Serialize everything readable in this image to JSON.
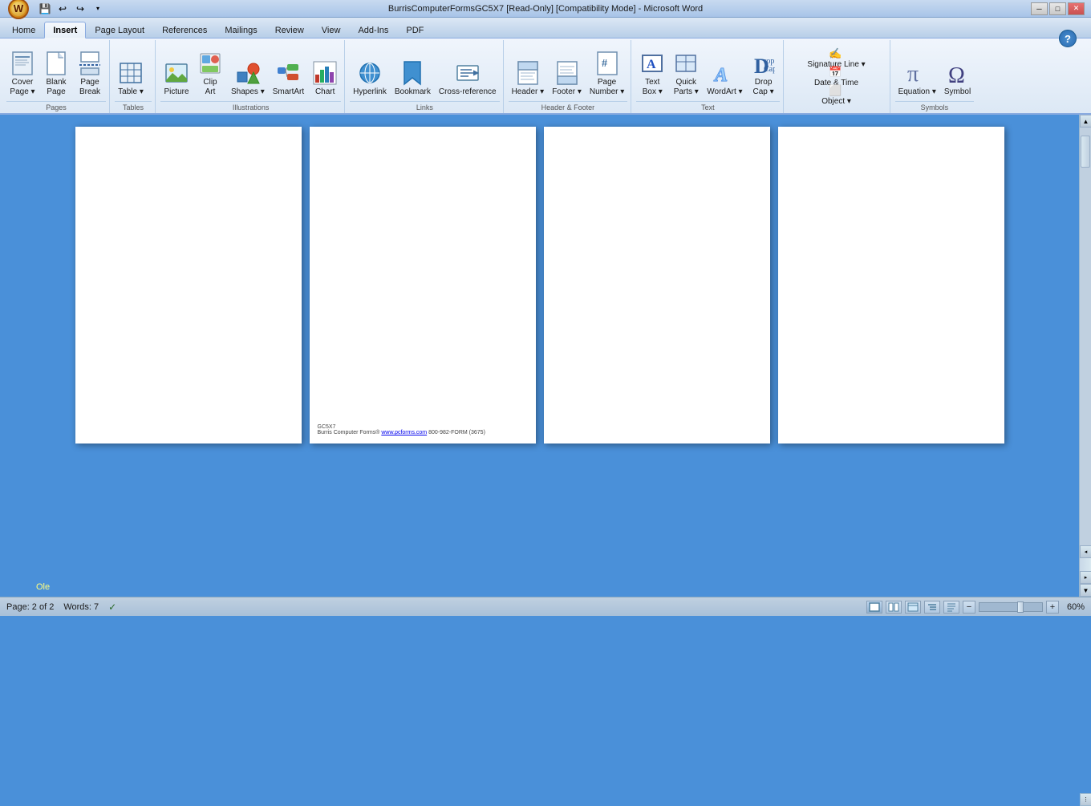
{
  "titlebar": {
    "title": "BurrisComputerFormsGC5X7 [Read-Only] [Compatibility Mode] - Microsoft Word",
    "minimize": "─",
    "restore": "□",
    "close": "✕"
  },
  "quickaccess": {
    "save_label": "💾",
    "undo_label": "↩",
    "redo_label": "↪",
    "dropdown_label": "▾"
  },
  "tabs": [
    {
      "id": "home",
      "label": "Home"
    },
    {
      "id": "insert",
      "label": "Insert",
      "active": true
    },
    {
      "id": "pagelayout",
      "label": "Page Layout"
    },
    {
      "id": "references",
      "label": "References"
    },
    {
      "id": "mailings",
      "label": "Mailings"
    },
    {
      "id": "review",
      "label": "Review"
    },
    {
      "id": "view",
      "label": "View"
    },
    {
      "id": "addins",
      "label": "Add-Ins"
    },
    {
      "id": "pdf",
      "label": "PDF"
    }
  ],
  "ribbon": {
    "groups": [
      {
        "id": "pages",
        "label": "Pages",
        "buttons": [
          {
            "id": "cover-page",
            "label": "Cover\nPage",
            "icon": "📄",
            "dropdown": true
          },
          {
            "id": "blank-page",
            "label": "Blank\nPage",
            "icon": "📃"
          },
          {
            "id": "page-break",
            "label": "Page\nBreak",
            "icon": "⬛"
          }
        ]
      },
      {
        "id": "tables",
        "label": "Tables",
        "buttons": [
          {
            "id": "table",
            "label": "Table",
            "icon": "⊞",
            "dropdown": true
          }
        ]
      },
      {
        "id": "illustrations",
        "label": "Illustrations",
        "buttons": [
          {
            "id": "picture",
            "label": "Picture",
            "icon": "🖼"
          },
          {
            "id": "clip-art",
            "label": "Clip\nArt",
            "icon": "✂"
          },
          {
            "id": "shapes",
            "label": "Shapes",
            "icon": "⬡",
            "dropdown": true
          },
          {
            "id": "smartart",
            "label": "SmartArt",
            "icon": "🔷"
          },
          {
            "id": "chart",
            "label": "Chart",
            "icon": "chart"
          }
        ]
      },
      {
        "id": "links",
        "label": "Links",
        "buttons": [
          {
            "id": "hyperlink",
            "label": "Hyperlink",
            "icon": "🌐"
          },
          {
            "id": "bookmark",
            "label": "Bookmark",
            "icon": "🔖"
          },
          {
            "id": "cross-reference",
            "label": "Cross-reference",
            "icon": "📎"
          }
        ]
      },
      {
        "id": "header-footer",
        "label": "Header & Footer",
        "buttons": [
          {
            "id": "header",
            "label": "Header",
            "icon": "▬",
            "dropdown": true
          },
          {
            "id": "footer",
            "label": "Footer",
            "icon": "▬",
            "dropdown": true
          },
          {
            "id": "page-number",
            "label": "Page\nNumber",
            "icon": "#",
            "dropdown": true
          }
        ]
      },
      {
        "id": "text",
        "label": "Text",
        "buttons": [
          {
            "id": "text-box",
            "label": "Text\nBox",
            "icon": "T",
            "dropdown": true
          },
          {
            "id": "quick-parts",
            "label": "Quick\nParts",
            "icon": "Q",
            "dropdown": true
          },
          {
            "id": "wordart",
            "label": "WordArt",
            "icon": "A",
            "dropdown": true
          },
          {
            "id": "drop-cap",
            "label": "Drop\nCap",
            "icon": "D",
            "dropdown": true
          }
        ]
      },
      {
        "id": "text2",
        "label": "",
        "small_buttons": [
          {
            "id": "signature-line",
            "label": "Signature Line",
            "icon": "✍",
            "dropdown": true
          },
          {
            "id": "date-time",
            "label": "Date & Time",
            "icon": "📅"
          },
          {
            "id": "object",
            "label": "Object",
            "icon": "⬜",
            "dropdown": true
          }
        ]
      },
      {
        "id": "symbols",
        "label": "Symbols",
        "buttons": [
          {
            "id": "equation",
            "label": "Equation",
            "icon": "π",
            "dropdown": true
          },
          {
            "id": "symbol",
            "label": "Symbol",
            "icon": "Ω"
          }
        ]
      }
    ]
  },
  "pages": [
    {
      "id": "page1",
      "has_footer": false,
      "footer_text": ""
    },
    {
      "id": "page2",
      "has_footer": true,
      "footer_line1": "GC5X7",
      "footer_line2": "Burris Computer Forms® www.pcforms.com 800-982-FORM (3675)"
    },
    {
      "id": "page3",
      "has_footer": false,
      "footer_text": ""
    },
    {
      "id": "page4",
      "has_footer": false,
      "footer_text": ""
    }
  ],
  "statusbar": {
    "page_label": "Page: 2 of 2",
    "words_label": "Words: 7",
    "check_icon": "✓",
    "zoom_level": "60%",
    "zoom_minus": "−",
    "zoom_plus": "+"
  },
  "ole_text": "Ole"
}
